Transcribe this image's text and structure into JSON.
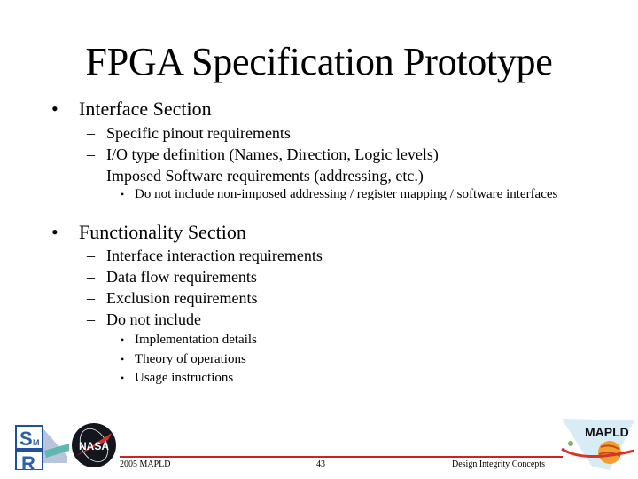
{
  "slide": {
    "title": "FPGA Specification Prototype",
    "sections": [
      {
        "bullet": "•",
        "heading": "Interface Section",
        "items": [
          {
            "marker": "–",
            "text": "Specific pinout requirements"
          },
          {
            "marker": "–",
            "text": "I/O type definition (Names, Direction, Logic levels)"
          },
          {
            "marker": "–",
            "text": "Imposed Software requirements (addressing, etc.)",
            "subitems": [
              {
                "marker": "•",
                "text": "Do not include non-imposed addressing / register mapping / software interfaces"
              }
            ]
          }
        ]
      },
      {
        "bullet": "•",
        "heading": "Functionality Section",
        "items": [
          {
            "marker": "–",
            "text": "Interface interaction requirements"
          },
          {
            "marker": "–",
            "text": "Data flow requirements"
          },
          {
            "marker": "–",
            "text": "Exclusion requirements"
          },
          {
            "marker": "–",
            "text": "Do not include",
            "subitems": [
              {
                "marker": "•",
                "text": "Implementation details"
              },
              {
                "marker": "•",
                "text": "Theory of operations"
              },
              {
                "marker": "•",
                "text": "Usage instructions"
              }
            ]
          }
        ]
      }
    ]
  },
  "footer": {
    "left": "2005 MAPLD",
    "center": "43",
    "right": "Design Integrity Concepts",
    "rule_color": "#cc2222"
  },
  "logos": {
    "left_logo_letters": [
      "S",
      "M",
      "R"
    ],
    "nasa_text": "NASA",
    "mapld_text": "MAPLD"
  }
}
